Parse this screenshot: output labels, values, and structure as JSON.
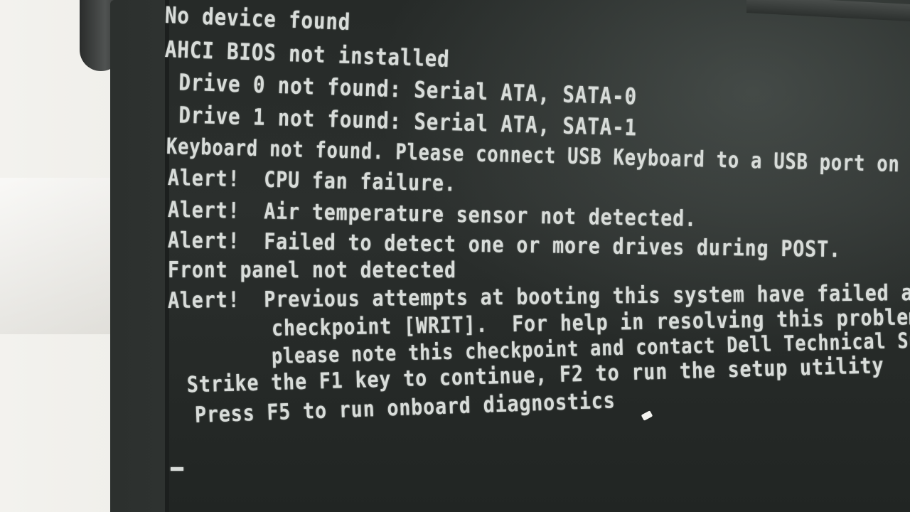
{
  "bios_screen": {
    "lines": [
      "No device found",
      "AHCI BIOS not installed",
      " Drive 0 not found: Serial ATA, SATA-0",
      " Drive 1 not found: Serial ATA, SATA-1",
      "Keyboard not found. Please connect USB Keyboard to a USB port on the c",
      "Alert!  CPU fan failure.",
      "Alert!  Air temperature sensor not detected.",
      "Alert!  Failed to detect one or more drives during POST.",
      "Front panel not detected",
      "Alert!  Previous attempts at booting this system have failed at",
      "checkpoint [WRIT].  For help in resolving this problem,",
      "please note this checkpoint and contact Dell Technical Support.",
      " Strike the F1 key to continue, F2 to run the setup utility",
      "Press F5 to run onboard diagnostics"
    ],
    "cursor": "_"
  }
}
